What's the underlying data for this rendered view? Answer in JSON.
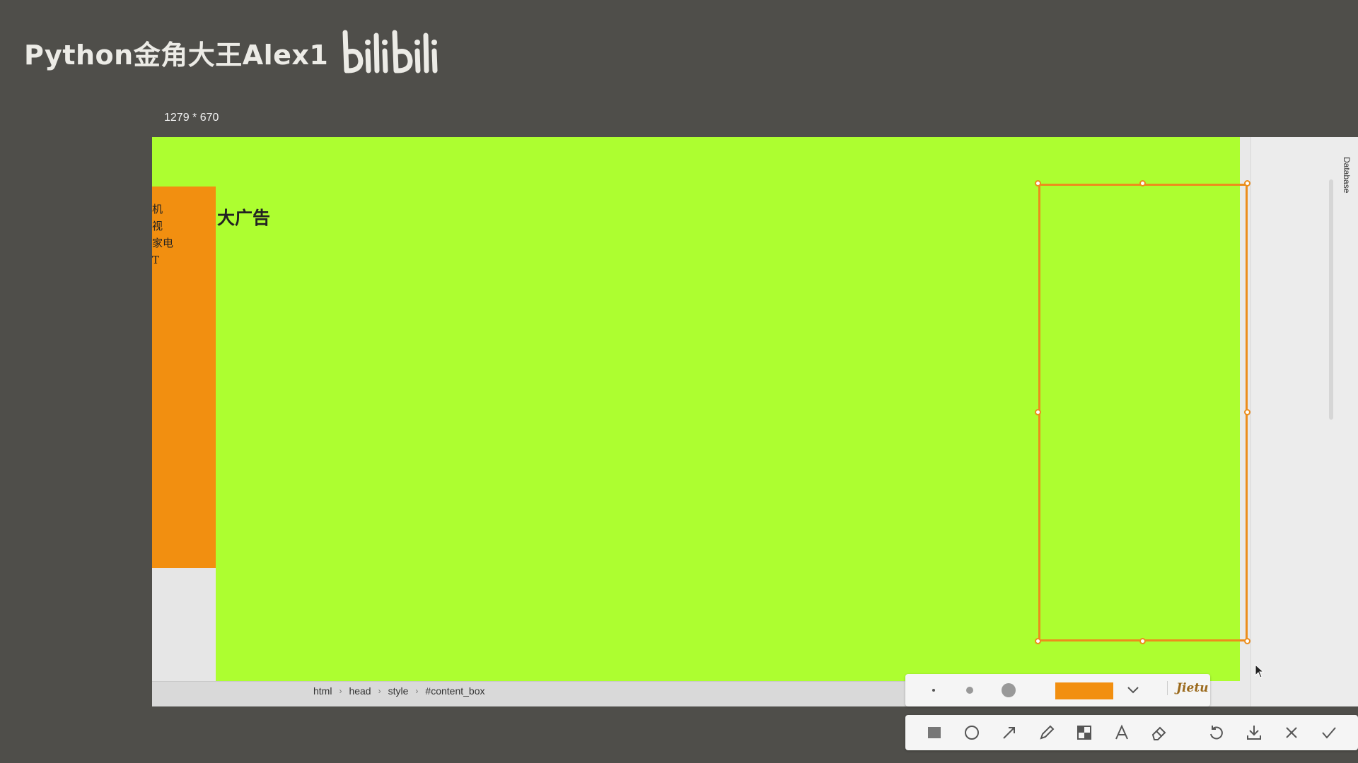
{
  "watermark": {
    "text": "Python金角大王Alex1",
    "logo_text": "bilibili"
  },
  "capture": {
    "dimensions_label": "1279 * 670"
  },
  "page": {
    "menu_items": [
      "机",
      "视",
      "家电",
      "T"
    ],
    "ad_title": "大广告"
  },
  "side_panel": {
    "database_label": "Database"
  },
  "breadcrumb": [
    "html",
    "head",
    "style",
    "#content_box"
  ],
  "toolbar": {
    "brand": "Jietu",
    "selected_color": "#f28f10",
    "brush_sizes": [
      "small",
      "medium",
      "large"
    ],
    "tools": [
      "rectangle-icon",
      "ellipse-icon",
      "arrow-icon",
      "pencil-icon",
      "mosaic-icon",
      "text-icon",
      "eraser-icon",
      "undo-icon",
      "download-icon",
      "close-icon",
      "confirm-icon"
    ]
  },
  "colors": {
    "page_green": "#adfe30",
    "menu_orange": "#f28f10",
    "selection_orange": "#ec8d1c",
    "background": "#4f4e4a"
  }
}
